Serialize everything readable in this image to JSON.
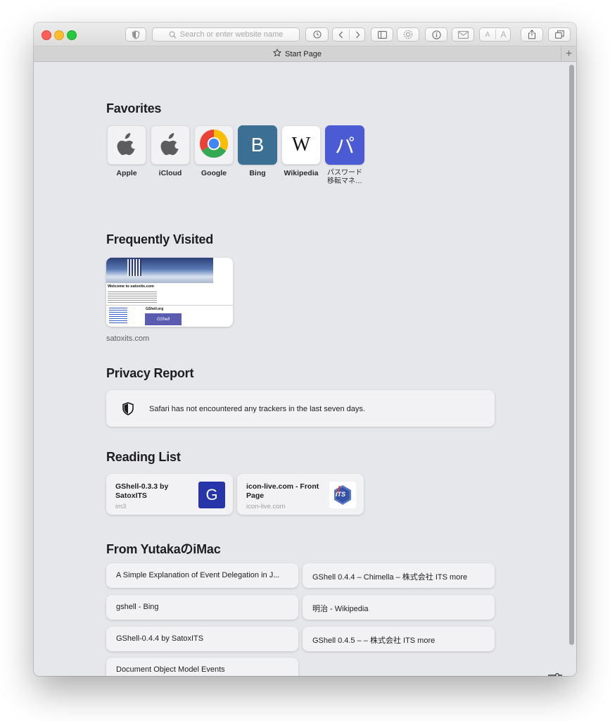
{
  "toolbar": {
    "search_placeholder": "Search or enter website name",
    "text_smaller": "A",
    "text_larger": "A"
  },
  "tab": {
    "title": "Start Page",
    "new_tab": "+"
  },
  "favorites": {
    "heading": "Favorites",
    "items": [
      {
        "label": "Apple",
        "icon": "apple-logo-icon"
      },
      {
        "label": "iCloud",
        "icon": "apple-logo-icon"
      },
      {
        "label": "Google",
        "icon": "chrome-logo-icon"
      },
      {
        "label": "Bing",
        "letter": "B",
        "color": "#3b6f93"
      },
      {
        "label": "Wikipedia",
        "letter": "W",
        "color": "#ffffff"
      },
      {
        "label": "パスワード\n移転マネ…",
        "letter": "パ",
        "color": "#4a5bd4"
      }
    ]
  },
  "frequently_visited": {
    "heading": "Frequently Visited",
    "items": [
      {
        "label": "satoxits.com",
        "thumb_title": "Welcome to satoxits.com",
        "thumb_link": "GShell.org",
        "thumb_button": "GShell"
      }
    ]
  },
  "privacy_report": {
    "heading": "Privacy Report",
    "text": "Safari has not encountered any trackers in the last seven days."
  },
  "reading_list": {
    "heading": "Reading List",
    "items": [
      {
        "title": "GShell-0.3.3 by SatoxITS",
        "subtitle": "im3",
        "icon_letter": "G",
        "icon_color": "#2636a8"
      },
      {
        "title": "icon-live.com - Front Page",
        "subtitle": "icon-live.com",
        "icon_letter": "ITS"
      }
    ]
  },
  "from_device": {
    "heading": "From YutakaのiMac",
    "items": [
      "A Simple Explanation of Event Delegation in J...",
      "GShell 0.4.4 – Chimella – 株式会社 ITS more",
      "gshell - Bing",
      "明治 - Wikipedia",
      "GShell-0.4.4 by SatoxITS",
      "GShell 0.4.5 – – 株式会社 ITS more",
      "Document Object Model Events"
    ]
  },
  "colors": {
    "page_background": "#e6e7eb",
    "card_background": "#f2f2f4",
    "close": "#fe5f57",
    "minimize": "#febc2e",
    "zoom": "#28c840"
  }
}
